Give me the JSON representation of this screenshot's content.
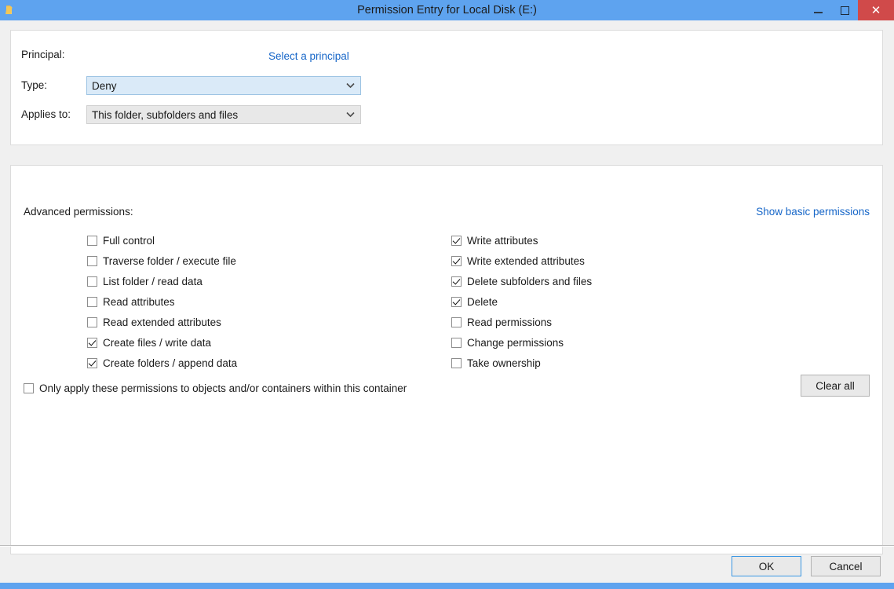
{
  "window": {
    "title": "Permission Entry for Local Disk (E:)",
    "icon": "folder-icon",
    "minimize_label": "–",
    "maximize_label": "☐",
    "close_label": "✕",
    "titlebar_color": "#5ea3ef",
    "close_button_color": "#d04a4a"
  },
  "principal_section": {
    "principal_label": "Principal:",
    "select_principal_link": "Select a principal",
    "type_label": "Type:",
    "type_value": "Deny",
    "applies_to_label": "Applies to:",
    "applies_to_value": "This folder, subfolders and files",
    "chevron_glyph": "⌄"
  },
  "permissions_section": {
    "heading": "Advanced permissions:",
    "show_basic_link": "Show basic permissions",
    "link_color": "#1666c8",
    "left_column": [
      {
        "label": "Full control",
        "checked": false
      },
      {
        "label": "Traverse folder / execute file",
        "checked": false
      },
      {
        "label": "List folder / read data",
        "checked": false
      },
      {
        "label": "Read attributes",
        "checked": false
      },
      {
        "label": "Read extended attributes",
        "checked": false
      },
      {
        "label": "Create files / write data",
        "checked": true
      },
      {
        "label": "Create folders / append data",
        "checked": true
      }
    ],
    "right_column": [
      {
        "label": "Write attributes",
        "checked": true
      },
      {
        "label": "Write extended attributes",
        "checked": true
      },
      {
        "label": "Delete subfolders and files",
        "checked": true
      },
      {
        "label": "Delete",
        "checked": true
      },
      {
        "label": "Read permissions",
        "checked": false
      },
      {
        "label": "Change permissions",
        "checked": false
      },
      {
        "label": "Take ownership",
        "checked": false
      }
    ],
    "only_apply": {
      "label": "Only apply these permissions to objects and/or containers within this container",
      "checked": false
    },
    "clear_all_label": "Clear all"
  },
  "footer": {
    "ok_label": "OK",
    "cancel_label": "Cancel"
  }
}
